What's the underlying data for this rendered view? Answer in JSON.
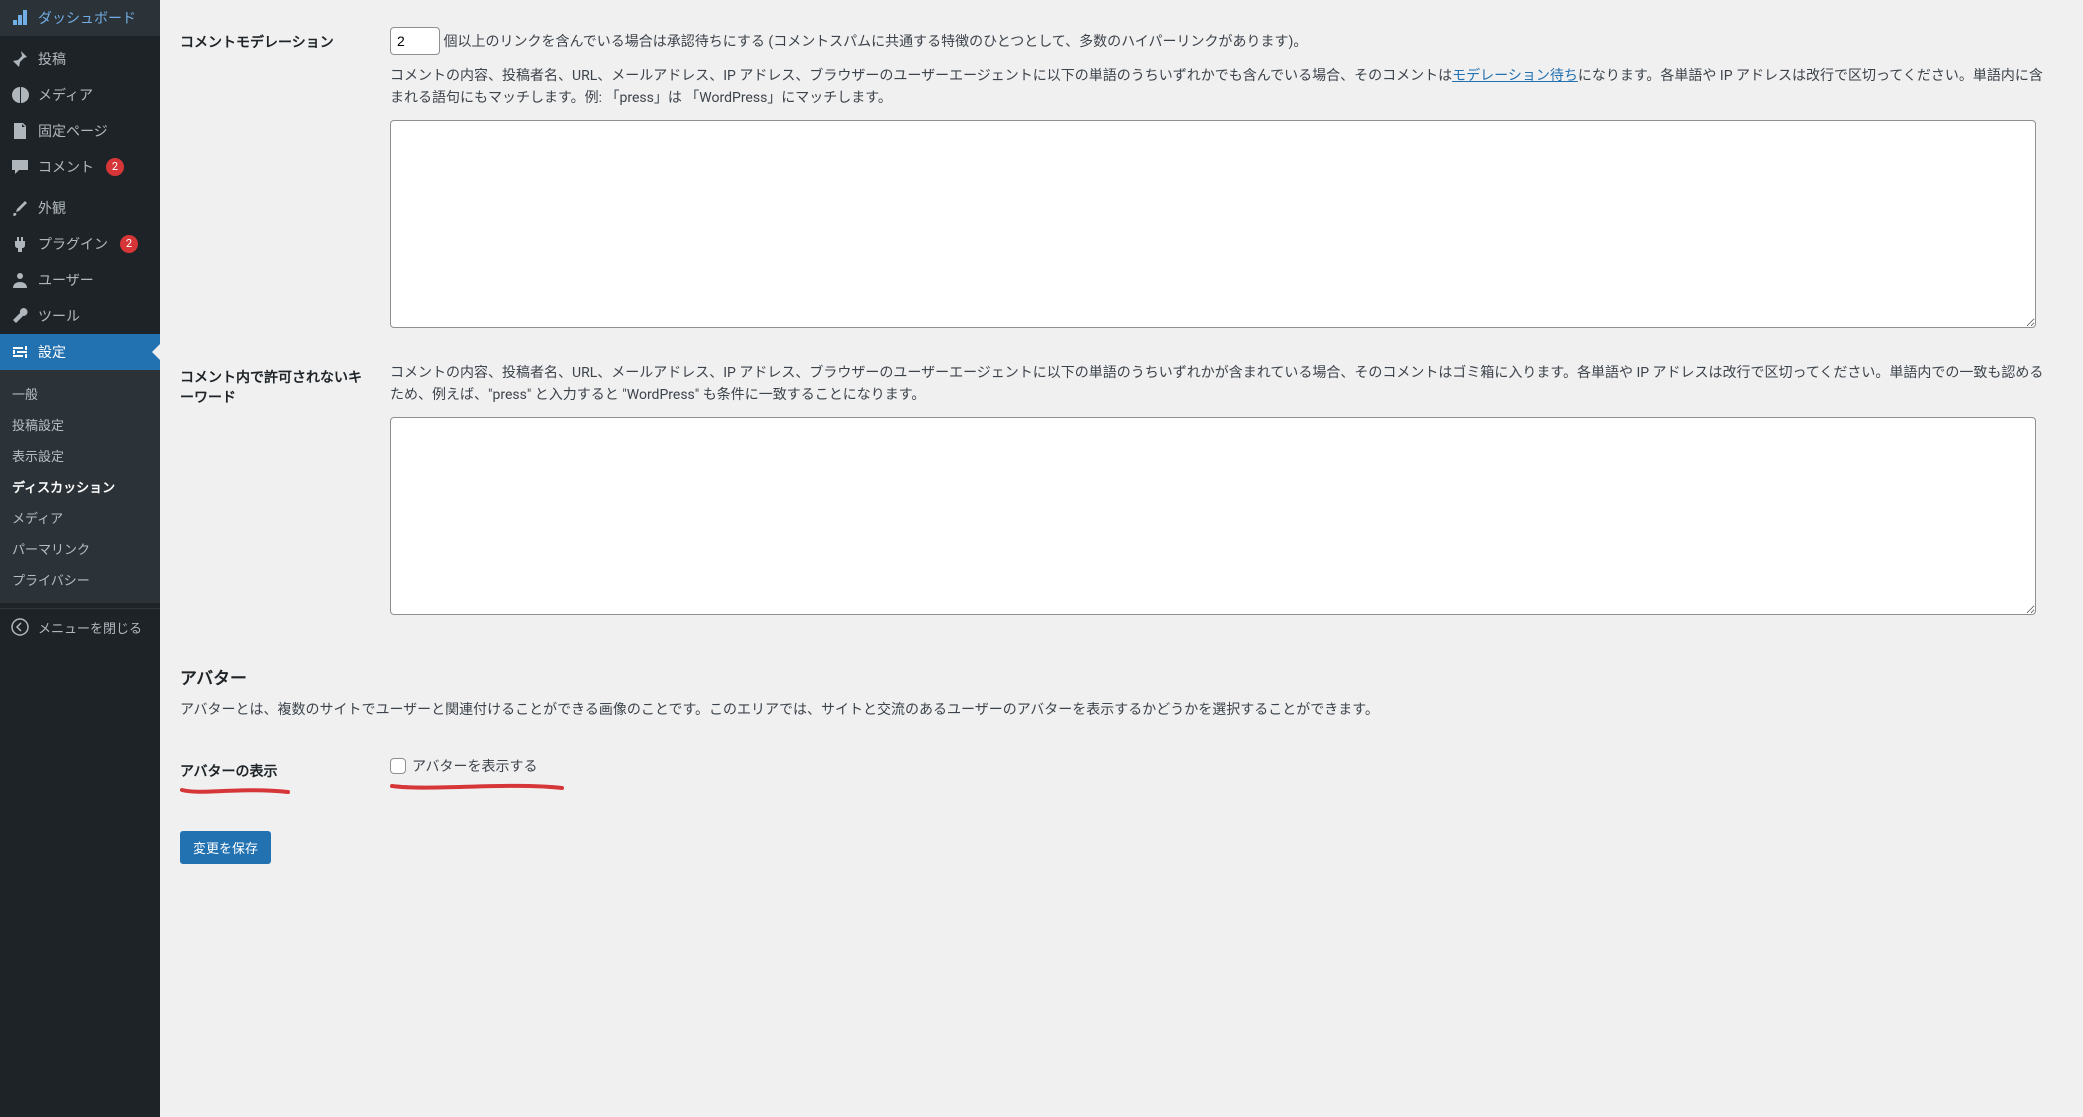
{
  "sidebar": {
    "items": [
      {
        "label": "ダッシュボード",
        "icon": "dashboard"
      },
      {
        "label": "投稿",
        "icon": "posts"
      },
      {
        "label": "メディア",
        "icon": "media"
      },
      {
        "label": "固定ページ",
        "icon": "pages"
      },
      {
        "label": "コメント",
        "icon": "comments",
        "badge": "2"
      },
      {
        "label": "外観",
        "icon": "appearance"
      },
      {
        "label": "プラグイン",
        "icon": "plugins",
        "badge": "2"
      },
      {
        "label": "ユーザー",
        "icon": "users"
      },
      {
        "label": "ツール",
        "icon": "tools"
      },
      {
        "label": "設定",
        "icon": "settings",
        "current": true
      }
    ],
    "submenu": [
      {
        "label": "一般"
      },
      {
        "label": "投稿設定"
      },
      {
        "label": "表示設定"
      },
      {
        "label": "ディスカッション",
        "active": true
      },
      {
        "label": "メディア"
      },
      {
        "label": "パーマリンク"
      },
      {
        "label": "プライバシー"
      }
    ],
    "collapse_label": "メニューを閉じる"
  },
  "moderation": {
    "row_label": "コメントモデレーション",
    "links_value": "2",
    "links_text_after": "個以上のリンクを含んでいる場合は承認待ちにする (コメントスパムに共通する特徴のひとつとして、多数のハイパーリンクがあります)。",
    "desc_before_link": "コメントの内容、投稿者名、URL、メールアドレス、IP アドレス、ブラウザーのユーザーエージェントに以下の単語のうちいずれかでも含んでいる場合、そのコメントは",
    "link_text": "モデレーション待ち",
    "desc_after_link": "になります。各単語や IP アドレスは改行で区切ってください。単語内に含まれる語句にもマッチします。例: 「press」は 「WordPress」にマッチします。",
    "textarea_value": ""
  },
  "disallowed": {
    "row_label": "コメント内で許可されないキーワード",
    "desc": "コメントの内容、投稿者名、URL、メールアドレス、IP アドレス、ブラウザーのユーザーエージェントに以下の単語のうちいずれかが含まれている場合、そのコメントはゴミ箱に入ります。各単語や IP アドレスは改行で区切ってください。単語内での一致も認めるため、例えば、\"press\" と入力すると \"WordPress\" も条件に一致することになります。",
    "textarea_value": ""
  },
  "avatar": {
    "heading": "アバター",
    "intro": "アバターとは、複数のサイトでユーザーと関連付けることができる画像のことです。このエリアでは、サイトと交流のあるユーザーのアバターを表示するかどうかを選択することができます。",
    "row_label": "アバターの表示",
    "checkbox_label": "アバターを表示する"
  },
  "submit": {
    "label": "変更を保存"
  },
  "colors": {
    "accent": "#2271b1",
    "badge": "#d63638",
    "annotation": "#d63638"
  }
}
